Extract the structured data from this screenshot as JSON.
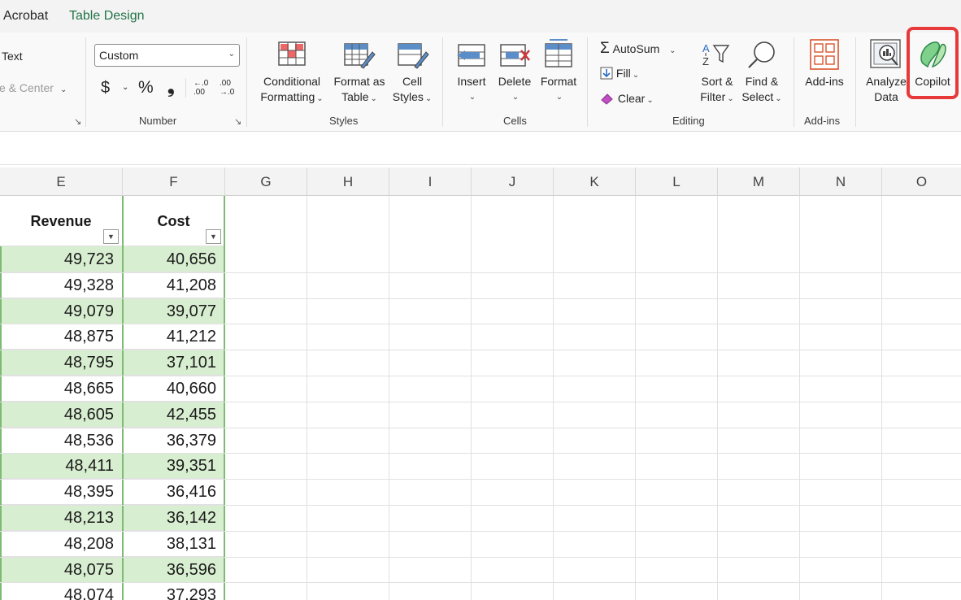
{
  "tabs": [
    {
      "label": "Acrobat"
    },
    {
      "label": "Table Design"
    }
  ],
  "ribbon": {
    "alignment": {
      "wrap_text": "Text",
      "merge_center": "e & Center"
    },
    "number": {
      "format_value": "Custom",
      "currency": "$",
      "percent": "%",
      "comma": "❟",
      "increase_decimal": "←.0 .00",
      "decrease_decimal": ".00 →.0",
      "group_label": "Number"
    },
    "styles": {
      "conditional_1": "Conditional",
      "conditional_2": "Formatting",
      "format_table_1": "Format as",
      "format_table_2": "Table",
      "cell_styles_1": "Cell",
      "cell_styles_2": "Styles",
      "group_label": "Styles"
    },
    "cells": {
      "insert": "Insert",
      "delete": "Delete",
      "format": "Format",
      "group_label": "Cells"
    },
    "editing": {
      "autosum": "AutoSum",
      "fill": "Fill",
      "clear": "Clear",
      "sort_1": "Sort &",
      "sort_2": "Filter",
      "find_1": "Find &",
      "find_2": "Select",
      "group_label": "Editing"
    },
    "addins": {
      "button": "Add-ins",
      "group_label": "Add-ins"
    },
    "analyze": {
      "line1": "Analyze",
      "line2": "Data"
    },
    "copilot": {
      "label": "Copilot"
    }
  },
  "columns": [
    "E",
    "F",
    "G",
    "H",
    "I",
    "J",
    "K",
    "L",
    "M",
    "N",
    "O"
  ],
  "table": {
    "headers": [
      "Revenue",
      "Cost"
    ],
    "rows": [
      [
        "49,723",
        "40,656"
      ],
      [
        "49,328",
        "41,208"
      ],
      [
        "49,079",
        "39,077"
      ],
      [
        "48,875",
        "41,212"
      ],
      [
        "48,795",
        "37,101"
      ],
      [
        "48,665",
        "40,660"
      ],
      [
        "48,605",
        "42,455"
      ],
      [
        "48,536",
        "36,379"
      ],
      [
        "48,411",
        "39,351"
      ],
      [
        "48,395",
        "36,416"
      ],
      [
        "48,213",
        "36,142"
      ],
      [
        "48,208",
        "38,131"
      ],
      [
        "48,075",
        "36,596"
      ],
      [
        "48,074",
        "37,293"
      ]
    ]
  },
  "colors": {
    "accent": "#217346",
    "band": "#d8eed1",
    "highlight": "#e8393a"
  }
}
